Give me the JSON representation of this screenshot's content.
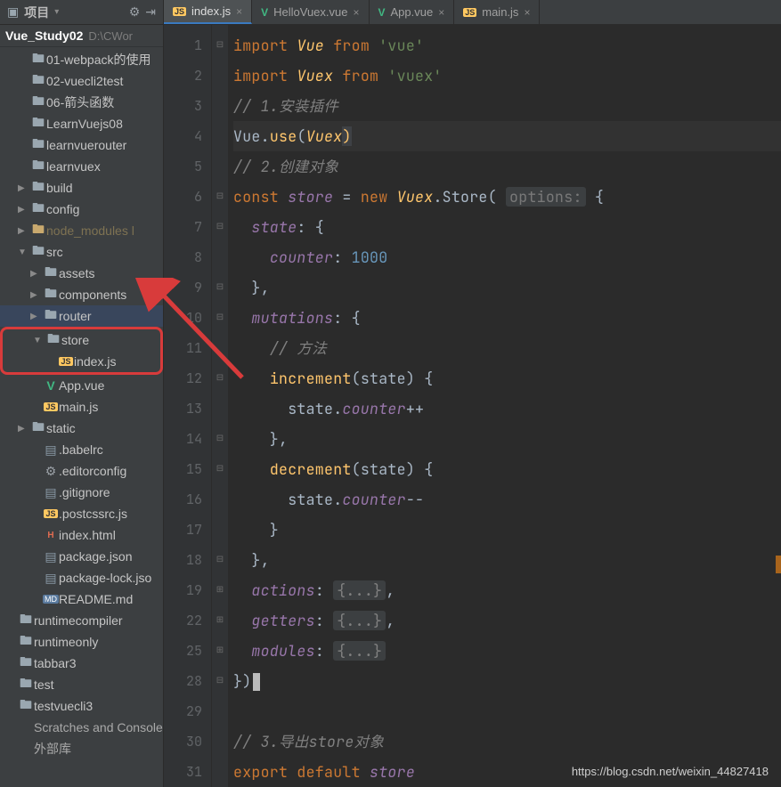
{
  "sidebar": {
    "header_title": "项目",
    "project_name": "Vue_Study02",
    "project_path": "D:\\CWor"
  },
  "tree": [
    {
      "indent": 1,
      "arrow": "none",
      "icon": "folder",
      "label": "01-webpack的使用"
    },
    {
      "indent": 1,
      "arrow": "none",
      "icon": "folder",
      "label": "02-vuecli2test"
    },
    {
      "indent": 1,
      "arrow": "none",
      "icon": "folder",
      "label": "06-箭头函数"
    },
    {
      "indent": 1,
      "arrow": "none",
      "icon": "folder",
      "label": "LearnVuejs08"
    },
    {
      "indent": 1,
      "arrow": "none",
      "icon": "folder",
      "label": "learnvuerouter"
    },
    {
      "indent": 1,
      "arrow": "none",
      "icon": "folder",
      "label": "learnvuex"
    },
    {
      "indent": 1,
      "arrow": "right",
      "icon": "folder",
      "label": "build"
    },
    {
      "indent": 1,
      "arrow": "right",
      "icon": "folder",
      "label": "config"
    },
    {
      "indent": 1,
      "arrow": "right",
      "icon": "folder-y",
      "label": "node_modules l",
      "muted": true
    },
    {
      "indent": 1,
      "arrow": "down",
      "icon": "folder",
      "label": "src"
    },
    {
      "indent": 2,
      "arrow": "right",
      "icon": "folder",
      "label": "assets"
    },
    {
      "indent": 2,
      "arrow": "right",
      "icon": "folder",
      "label": "components"
    },
    {
      "indent": 2,
      "arrow": "right",
      "icon": "folder",
      "label": "router",
      "selected": true
    },
    {
      "indent": 2,
      "arrow": "down",
      "icon": "folder",
      "label": "store",
      "boxStart": true
    },
    {
      "indent": 3,
      "arrow": "none",
      "icon": "js",
      "label": "index.js",
      "boxEnd": true
    },
    {
      "indent": 2,
      "arrow": "none",
      "icon": "vue",
      "label": "App.vue"
    },
    {
      "indent": 2,
      "arrow": "none",
      "icon": "js",
      "label": "main.js"
    },
    {
      "indent": 1,
      "arrow": "right",
      "icon": "folder",
      "label": "static"
    },
    {
      "indent": 2,
      "arrow": "none",
      "icon": "file",
      "label": ".babelrc"
    },
    {
      "indent": 2,
      "arrow": "none",
      "icon": "gear",
      "label": ".editorconfig"
    },
    {
      "indent": 2,
      "arrow": "none",
      "icon": "file",
      "label": ".gitignore"
    },
    {
      "indent": 2,
      "arrow": "none",
      "icon": "js",
      "label": ".postcssrc.js"
    },
    {
      "indent": 2,
      "arrow": "none",
      "icon": "html",
      "label": "index.html"
    },
    {
      "indent": 2,
      "arrow": "none",
      "icon": "file",
      "label": "package.json"
    },
    {
      "indent": 2,
      "arrow": "none",
      "icon": "file",
      "label": "package-lock.jso"
    },
    {
      "indent": 2,
      "arrow": "none",
      "icon": "md",
      "label": "README.md"
    },
    {
      "indent": 0,
      "arrow": "none",
      "icon": "folder",
      "label": "runtimecompiler"
    },
    {
      "indent": 0,
      "arrow": "none",
      "icon": "folder",
      "label": "runtimeonly"
    },
    {
      "indent": 0,
      "arrow": "none",
      "icon": "folder",
      "label": "tabbar3"
    },
    {
      "indent": 0,
      "arrow": "none",
      "icon": "folder",
      "label": "test"
    },
    {
      "indent": 0,
      "arrow": "none",
      "icon": "folder",
      "label": "testvuecli3"
    },
    {
      "indent": 0,
      "arrow": "none",
      "icon": "label",
      "label": "Scratches and Console",
      "extra": true
    },
    {
      "indent": 0,
      "arrow": "none",
      "icon": "label",
      "label": "外部库",
      "extra": true
    }
  ],
  "tabs": [
    {
      "icon": "js",
      "label": "index.js",
      "active": true
    },
    {
      "icon": "vue",
      "label": "HelloVuex.vue",
      "active": false
    },
    {
      "icon": "vue",
      "label": "App.vue",
      "active": false
    },
    {
      "icon": "js",
      "label": "main.js",
      "active": false
    }
  ],
  "gutter_lines": [
    "1",
    "2",
    "3",
    "4",
    "5",
    "6",
    "7",
    "8",
    "9",
    "10",
    "11",
    "12",
    "13",
    "14",
    "15",
    "16",
    "17",
    "18",
    "19",
    "22",
    "25",
    "28",
    "29",
    "30",
    "31"
  ],
  "code": {
    "l1": {
      "kw": "import",
      "cls": "Vue",
      "from": "from",
      "str": "'vue'"
    },
    "l2": {
      "kw": "import",
      "cls": "Vuex",
      "from": "from",
      "str": "'vuex'"
    },
    "l3": "// 1.安装插件",
    "l4": {
      "v": "Vue",
      "dot": ".",
      "use": "use",
      "open": "(",
      "arg": "Vuex",
      "close": ")"
    },
    "l5": "// 2.创建对象",
    "l6": {
      "c": "const",
      "name": "store",
      "eq": " = ",
      "new": "new",
      "vx": "Vuex",
      "store": ".Store(",
      "hint": "options:",
      "brace": " {"
    },
    "l7": {
      "prop": "state",
      "rest": ": {"
    },
    "l8": {
      "prop": "counter",
      "colon": ": ",
      "val": "1000"
    },
    "l9": "},",
    "l10": {
      "prop": "mutations",
      "rest": ": {"
    },
    "l11": "// 方法",
    "l12": {
      "fn": "increment",
      "sig": "(state) {"
    },
    "l13": {
      "a": "state.",
      "b": "counter",
      "c": "++"
    },
    "l14": "},",
    "l15": {
      "fn": "decrement",
      "sig": "(state) {"
    },
    "l16": {
      "a": "state.",
      "b": "counter",
      "c": "--"
    },
    "l17": "}",
    "l18": "},",
    "l19": {
      "prop": "actions",
      "rest": ": ",
      "fold": "{...}",
      "comma": ","
    },
    "l22": {
      "prop": "getters",
      "rest": ": ",
      "fold": "{...}",
      "comma": ","
    },
    "l25": {
      "prop": "modules",
      "rest": ": ",
      "fold": "{...}"
    },
    "l28": "})",
    "l30": "// 3.导出store对象",
    "l31": {
      "e": "export",
      "d": "default",
      "s": "store"
    }
  },
  "watermark": "https://blog.csdn.net/weixin_44827418"
}
